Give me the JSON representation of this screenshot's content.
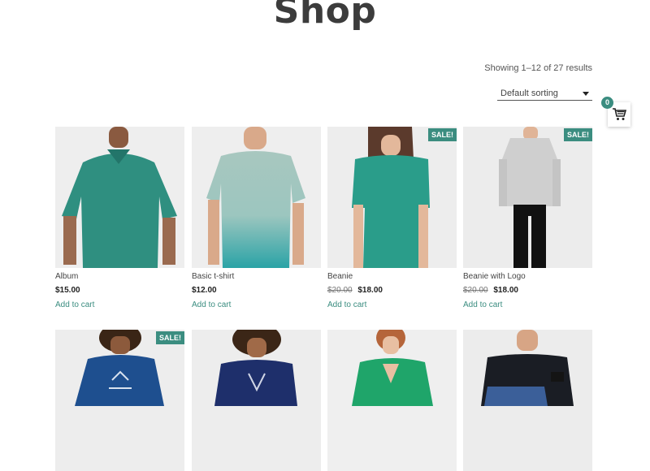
{
  "header": {
    "title": "Shop"
  },
  "toolbar": {
    "result_count": "Showing 1–12 of 27 results",
    "sort_selected": "Default sorting"
  },
  "cart": {
    "count": "0",
    "icon": "cart-icon"
  },
  "colors": {
    "accent": "#3b8d80",
    "shirt_teal": "#2f8f80",
    "shirt_navy": "#1e3f7a"
  },
  "products": [
    {
      "title": "Album",
      "price": "$15.00",
      "old_price": "",
      "sale": "",
      "cta": "Add to cart"
    },
    {
      "title": "Basic t-shirt",
      "price": "$12.00",
      "old_price": "",
      "sale": "",
      "cta": "Add to cart"
    },
    {
      "title": "Beanie",
      "price": "$18.00",
      "old_price": "$20.00",
      "sale": "SALE!",
      "cta": "Add to cart"
    },
    {
      "title": "Beanie with Logo",
      "price": "$18.00",
      "old_price": "$20.00",
      "sale": "SALE!",
      "cta": "Add to cart"
    },
    {
      "title": "",
      "price": "",
      "old_price": "",
      "sale": "SALE!",
      "cta": ""
    },
    {
      "title": "",
      "price": "",
      "old_price": "",
      "sale": "",
      "cta": ""
    },
    {
      "title": "",
      "price": "",
      "old_price": "",
      "sale": "",
      "cta": ""
    },
    {
      "title": "",
      "price": "",
      "old_price": "",
      "sale": "",
      "cta": ""
    }
  ]
}
